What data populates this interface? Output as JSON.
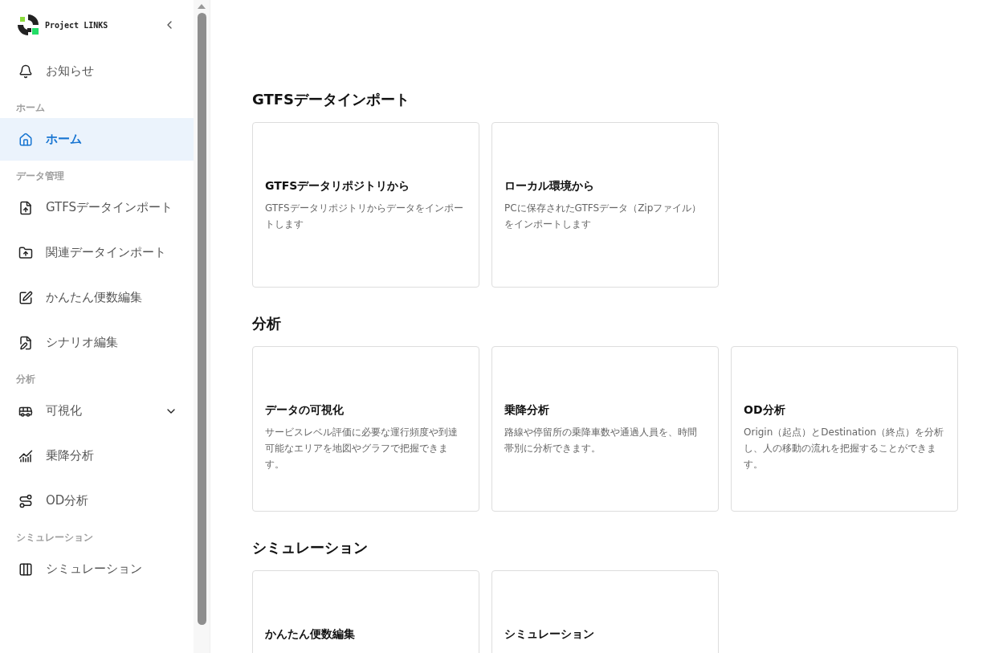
{
  "brand": {
    "name": "Project LINKS"
  },
  "notice": {
    "label": "お知らせ"
  },
  "sidebar": {
    "items": [
      {
        "kind": "section",
        "label": "ホーム"
      },
      {
        "kind": "link",
        "label": "ホーム",
        "selected": true
      },
      {
        "kind": "section",
        "label": "データ管理"
      },
      {
        "kind": "link",
        "label": "GTFSデータインポート",
        "selected": false
      },
      {
        "kind": "link",
        "label": "関連データインポート",
        "selected": false
      },
      {
        "kind": "link",
        "label": "かんたん便数編集",
        "selected": false
      },
      {
        "kind": "link",
        "label": "シナリオ編集",
        "selected": false
      },
      {
        "kind": "section",
        "label": "分析"
      },
      {
        "kind": "group",
        "label": "可視化",
        "selected": false,
        "expanded": false
      },
      {
        "kind": "link",
        "label": "乗降分析",
        "selected": false
      },
      {
        "kind": "link",
        "label": "OD分析",
        "selected": false
      },
      {
        "kind": "section",
        "label": "シミュレーション"
      },
      {
        "kind": "link",
        "label": "シミュレーション",
        "selected": false
      }
    ]
  },
  "sections": [
    {
      "title": "GTFSデータインポート",
      "cards": [
        {
          "title": "GTFSデータリポジトリから",
          "description": "GTFSデータリポジトリからデータをインポートします"
        },
        {
          "title": "ローカル環境から",
          "description": "PCに保存されたGTFSデータ（Zipファイル）をインポートします"
        }
      ]
    },
    {
      "title": "分析",
      "cards": [
        {
          "title": "データの可視化",
          "description": "サービスレベル評価に必要な運行頻度や到達可能なエリアを地図やグラフで把握できます。"
        },
        {
          "title": "乗降分析",
          "description": "路線や停留所の乗降車数や通過人員を、時間帯別に分析できます。"
        },
        {
          "title": "OD分析",
          "description": "Origin（起点）とDestination（終点）を分析し、人の移動の流れを把握することができます。"
        }
      ]
    },
    {
      "title": "シミュレーション",
      "cards": [
        {
          "title": "かんたん便数編集"
        },
        {
          "title": "シミュレーション"
        }
      ]
    }
  ]
}
